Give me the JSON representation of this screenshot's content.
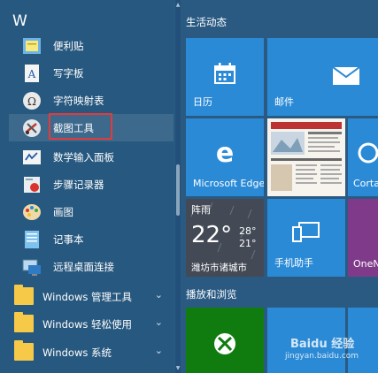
{
  "applist": {
    "section_letter": "W",
    "apps": [
      {
        "label": "便利贴",
        "icon": "sticky-notes-icon"
      },
      {
        "label": "写字板",
        "icon": "wordpad-icon"
      },
      {
        "label": "字符映射表",
        "icon": "character-map-icon"
      },
      {
        "label": "截图工具",
        "icon": "snipping-tool-icon"
      },
      {
        "label": "数学输入面板",
        "icon": "math-input-icon"
      },
      {
        "label": "步骤记录器",
        "icon": "steps-recorder-icon"
      },
      {
        "label": "画图",
        "icon": "paint-icon"
      },
      {
        "label": "记事本",
        "icon": "notepad-icon"
      },
      {
        "label": "远程桌面连接",
        "icon": "remote-desktop-icon"
      }
    ],
    "folders": [
      {
        "label": "Windows 管理工具"
      },
      {
        "label": "Windows 轻松使用"
      },
      {
        "label": "Windows 系统"
      }
    ],
    "chevron": "⌄"
  },
  "tiles": {
    "group1_title": "生活动态",
    "group2_title": "播放和浏览",
    "calendar_label": "日历",
    "mail_label": "邮件",
    "edge_label": "Microsoft Edge",
    "cortana_label": "Cortar",
    "weather_condition": "阵雨",
    "weather_temp": "22°",
    "weather_high": "28°",
    "weather_low": "21°",
    "weather_location": "潍坊市诸城市",
    "phone_label": "手机助手",
    "onenote_label": "OneN",
    "watermark_text": "Baidu 经验",
    "watermark_url": "jingyan.baidu.com"
  },
  "colors": {
    "tile_blue": "#2b8ad6",
    "xbox_green": "#107c10",
    "onenote_purple": "#7f3b8a",
    "highlight_red": "#e23b3b"
  }
}
